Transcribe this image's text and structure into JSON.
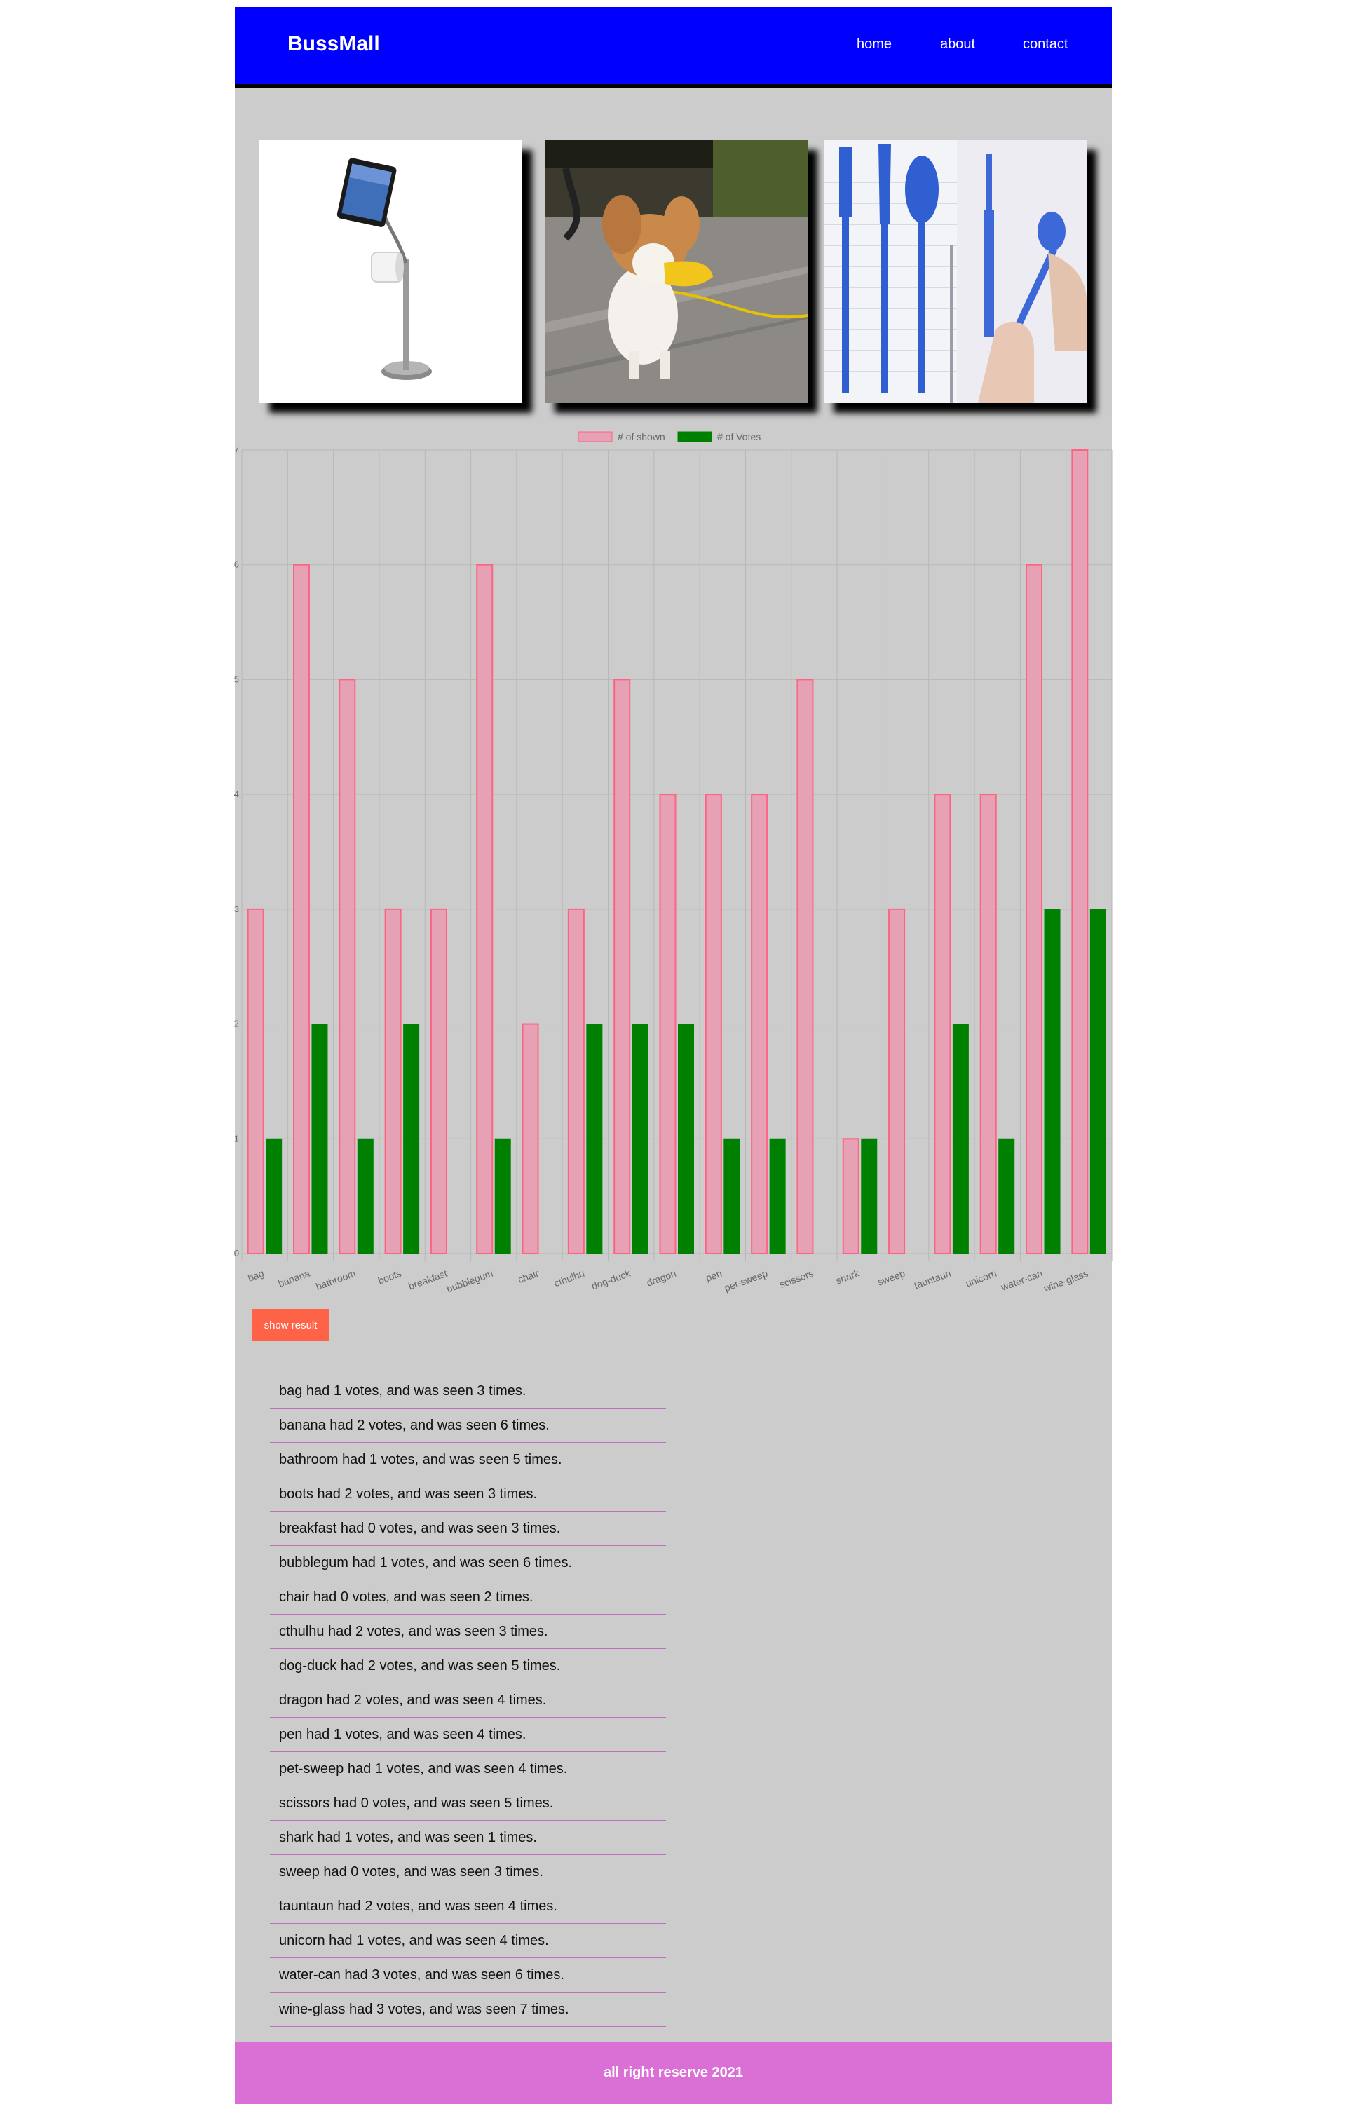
{
  "header": {
    "logo": "BussMall",
    "nav": [
      {
        "label": "home"
      },
      {
        "label": "about"
      },
      {
        "label": "contact"
      }
    ],
    "background": "#0000ff"
  },
  "products": [
    {
      "name": "bathroom",
      "icon": "tablet-toilet-paper-stand-image"
    },
    {
      "name": "dog-duck",
      "icon": "dog-duck-muzzle-image"
    },
    {
      "name": "pen",
      "icon": "utensil-pen-image"
    }
  ],
  "chart_data": {
    "type": "bar",
    "categories": [
      "bag",
      "banana",
      "bathroom",
      "boots",
      "breakfast",
      "bubblegum",
      "chair",
      "cthulhu",
      "dog-duck",
      "dragon",
      "pen",
      "pet-sweep",
      "scissors",
      "shark",
      "sweep",
      "tauntaun",
      "unicorn",
      "water-can",
      "wine-glass"
    ],
    "series": [
      {
        "name": "# of shown",
        "values": [
          3,
          6,
          5,
          3,
          3,
          6,
          2,
          3,
          5,
          4,
          4,
          4,
          5,
          1,
          3,
          4,
          4,
          6,
          7
        ],
        "color": "#e6a2b4",
        "border": "#ff6384"
      },
      {
        "name": "# of Votes",
        "values": [
          1,
          2,
          1,
          2,
          0,
          1,
          0,
          2,
          2,
          2,
          1,
          1,
          0,
          1,
          0,
          2,
          1,
          3,
          3
        ],
        "color": "#008000",
        "border": "#008000"
      }
    ],
    "yticks": [
      "0",
      "1",
      "2",
      "3",
      "4",
      "5",
      "6",
      "7"
    ],
    "ylim": [
      0,
      7
    ],
    "grid": true,
    "legend": "top"
  },
  "show_result_label": "show result",
  "results": [
    "bag had 1 votes, and was seen 3 times.",
    "banana had 2 votes, and was seen 6 times.",
    "bathroom had 1 votes, and was seen 5 times.",
    "boots had 2 votes, and was seen 3 times.",
    "breakfast had 0 votes, and was seen 3 times.",
    "bubblegum had 1 votes, and was seen 6 times.",
    "chair had 0 votes, and was seen 2 times.",
    "cthulhu had 2 votes, and was seen 3 times.",
    "dog-duck had 2 votes, and was seen 5 times.",
    "dragon had 2 votes, and was seen 4 times.",
    "pen had 1 votes, and was seen 4 times.",
    "pet-sweep had 1 votes, and was seen 4 times.",
    "scissors had 0 votes, and was seen 5 times.",
    "shark had 1 votes, and was seen 1 times.",
    "sweep had 0 votes, and was seen 3 times.",
    "tauntaun had 2 votes, and was seen 4 times.",
    "unicorn had 1 votes, and was seen 4 times.",
    "water-can had 3 votes, and was seen 6 times.",
    "wine-glass had 3 votes, and was seen 7 times."
  ],
  "footer": {
    "text": "all right reserve 2021",
    "background": "#da70d6"
  }
}
